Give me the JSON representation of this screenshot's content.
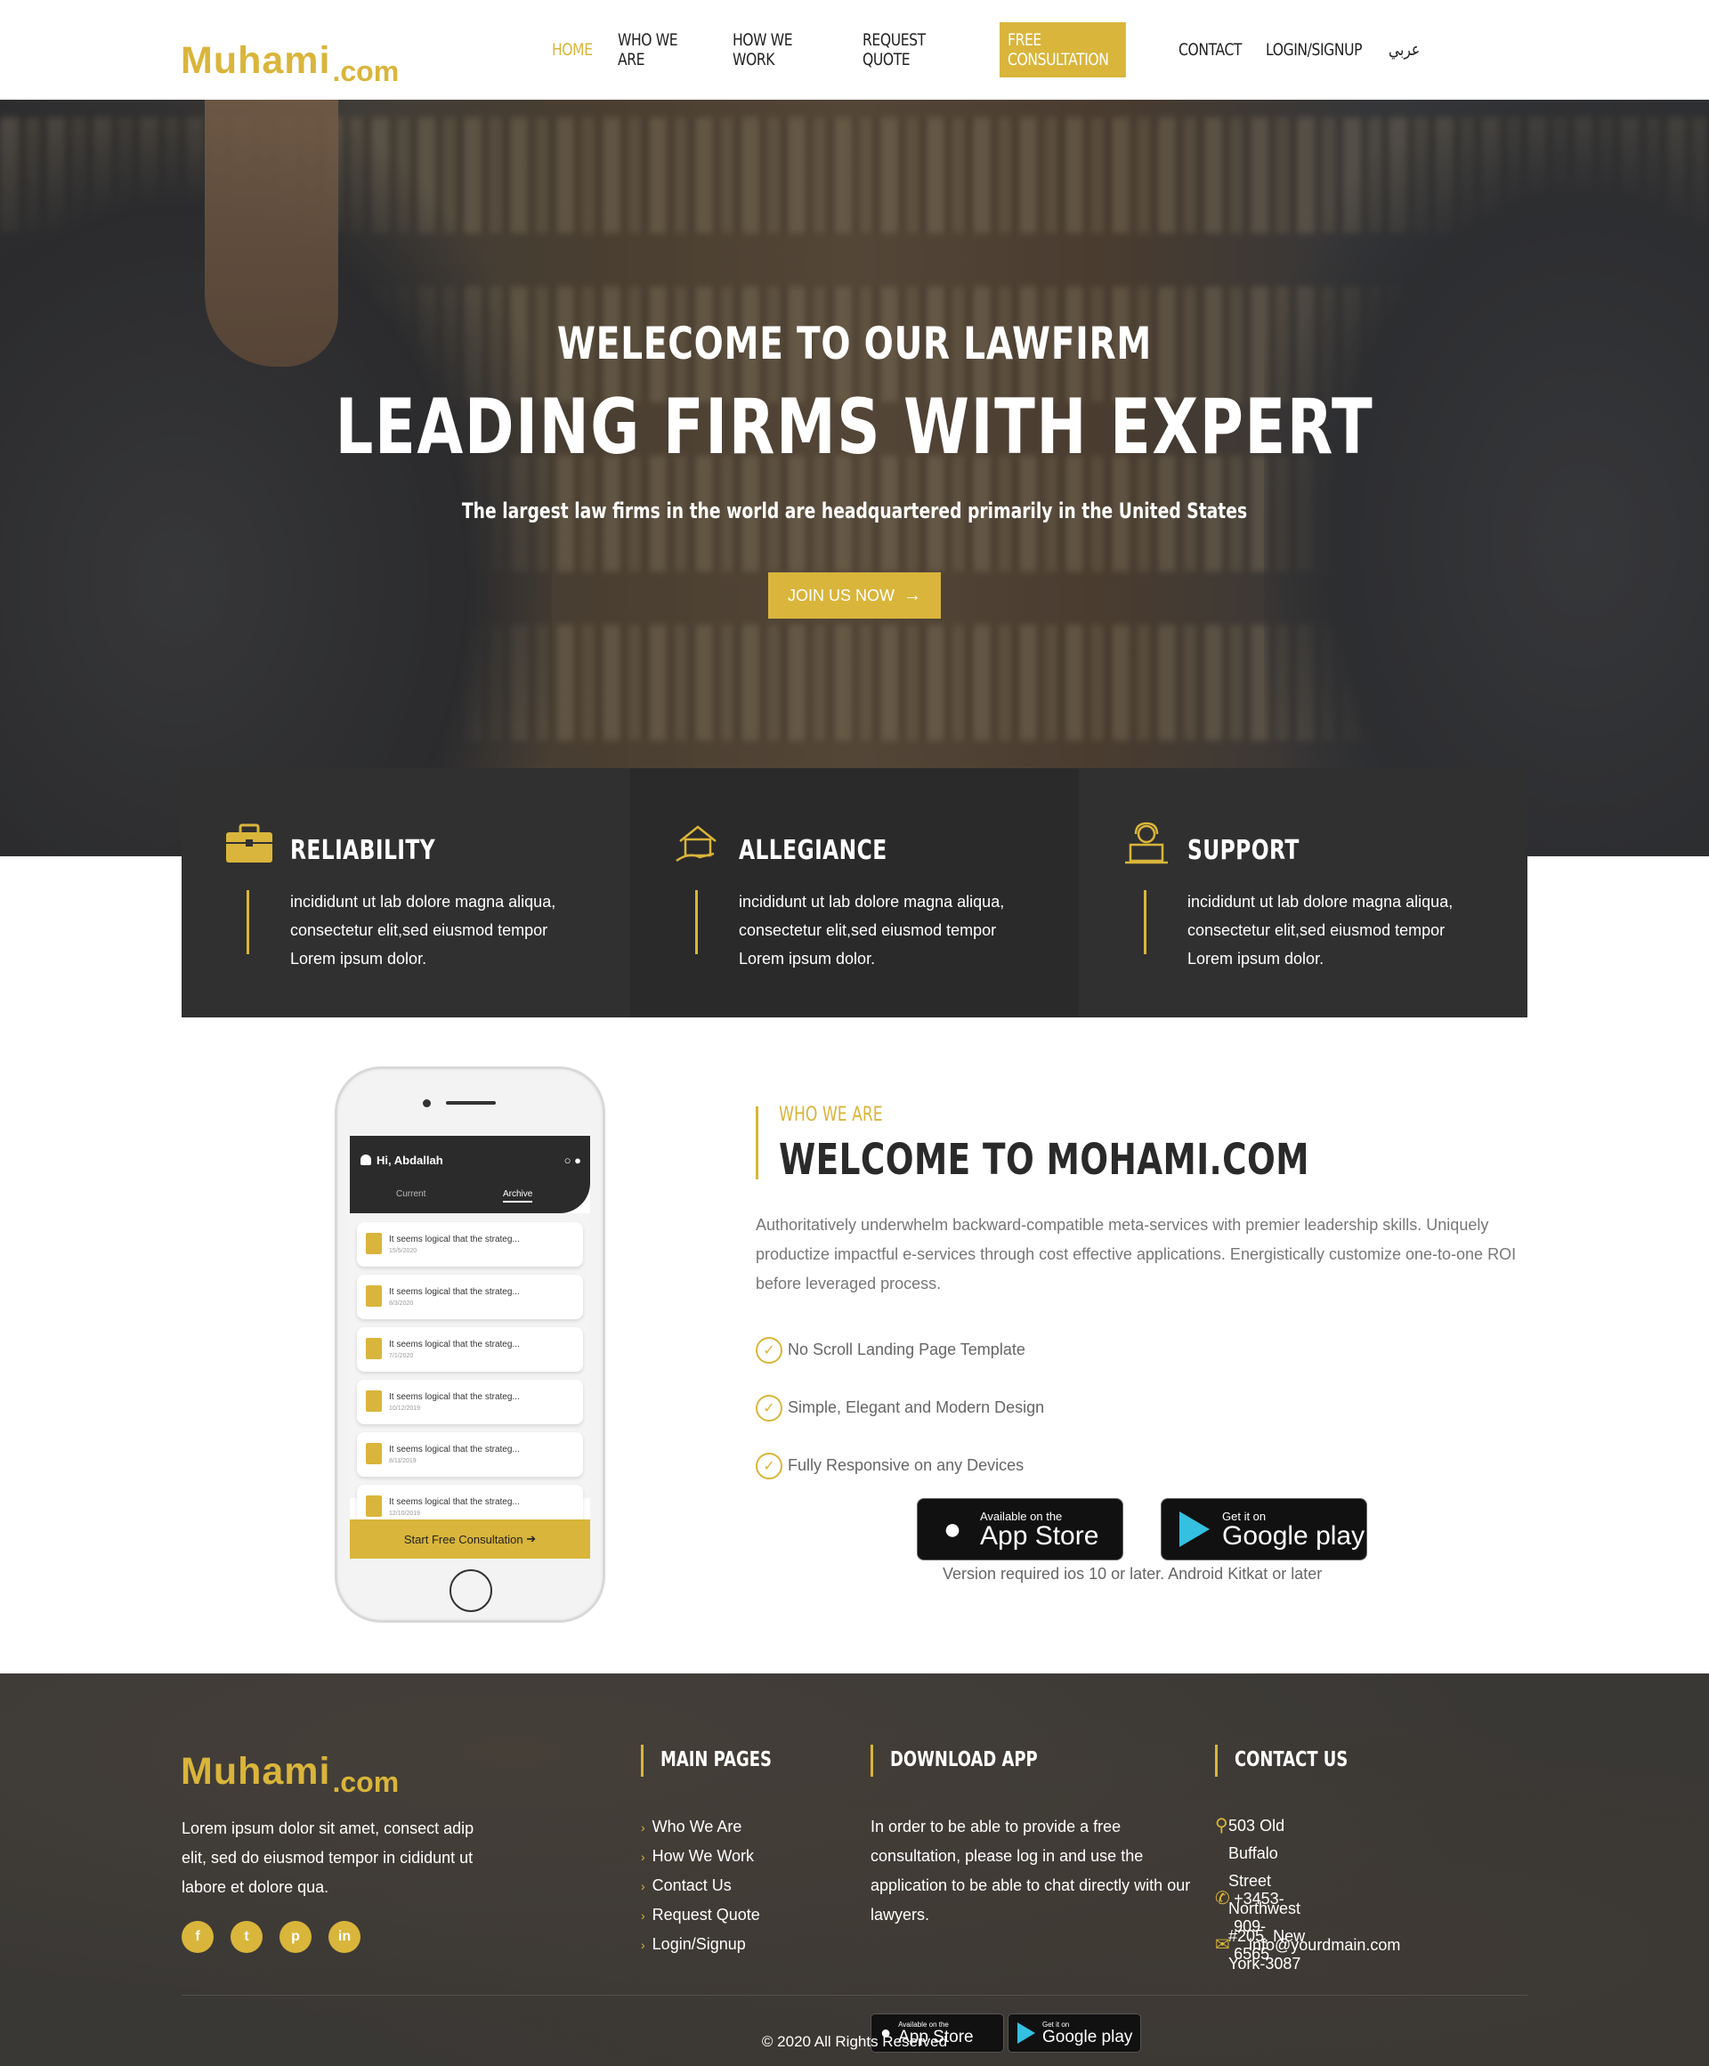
{
  "brand": {
    "logo_main": "Muhami",
    "logo_suffix": ".com"
  },
  "nav": {
    "items": [
      "HOME",
      "WHO WE ARE",
      "HOW WE WORK",
      "REQUEST QUOTE",
      "FREE CONSULTATION",
      "CONTACT",
      "LOGIN/SIGNUP",
      "عربي"
    ],
    "active": "HOME",
    "cta": "FREE CONSULTATION"
  },
  "hero": {
    "welcome": "WELECOME TO OUR LAWFIRM",
    "headline": "LEADING FIRMS WITH EXPERT",
    "subtitle": "The largest law firms in the world are headquartered primarily in the United States",
    "button_label": "JOIN US NOW",
    "button_icon": "arrow-right-icon"
  },
  "features": [
    {
      "title": "RELIABILITY",
      "icon": "briefcase-icon",
      "text": "incididunt ut lab dolore magna aliqua, consectetur elit,sed eiusmod tempor Lorem ipsum dolor."
    },
    {
      "title": "ALLEGIANCE",
      "icon": "house-hand-icon",
      "text": "incididunt ut lab dolore magna aliqua, consectetur elit,sed eiusmod tempor Lorem ipsum dolor."
    },
    {
      "title": "SUPPORT",
      "icon": "support-agent-icon",
      "text": "incididunt ut lab dolore magna aliqua, consectetur elit,sed eiusmod tempor Lorem ipsum dolor."
    }
  ],
  "phone_app": {
    "greeting": "Hi, Abdallah",
    "tabs": [
      "Current",
      "Archive"
    ],
    "items": [
      {
        "title": "It seems logical that the strateg...",
        "date": "15/5/2020"
      },
      {
        "title": "It seems logical that the strateg...",
        "date": "8/3/2020"
      },
      {
        "title": "It seems logical that the strateg...",
        "date": "7/1/2020"
      },
      {
        "title": "It seems logical that the strateg...",
        "date": "10/12/2019"
      },
      {
        "title": "It seems logical that the strateg...",
        "date": "8/11/2019"
      },
      {
        "title": "It seems logical that the strateg...",
        "date": "12/10/2019"
      }
    ],
    "start_button": "Start Free Consultation"
  },
  "about": {
    "kicker": "WHO WE ARE",
    "title": "WELCOME TO MOHAMI.COM",
    "description": "Authoritatively underwhelm backward-compatible meta-services with premier leadership skills. Uniquely productize impactful e-services through cost effective applications. Energistically customize one-to-one ROI before leveraged process.",
    "checks": [
      "No Scroll Landing Page Template",
      "Simple, Elegant and Modern Design",
      "Fully Responsive on any Devices"
    ],
    "app_store": {
      "small": "Available on the",
      "big": "App Store"
    },
    "google_play": {
      "small": "Get it on",
      "big": "Google play"
    },
    "version_note": "Version required ios 10 or later. Android Kitkat or later"
  },
  "footer": {
    "about_text": "Lorem ipsum dolor sit amet, consect adip elit, sed do eiusmod tempor in cididunt ut labore et dolore qua.",
    "socials": [
      "facebook-icon",
      "twitter-icon",
      "pinterest-icon",
      "linkedin-icon"
    ],
    "main_pages": {
      "title": "MAIN PAGES",
      "links": [
        "Who We Are",
        "How We Work",
        "Contact Us",
        "Request Quote",
        "Login/Signup"
      ]
    },
    "download_app": {
      "title": "DOWNLOAD APP",
      "text": "In order to be able to provide a free consultation, please log in and use the application to be able to chat directly with our lawyers."
    },
    "contact": {
      "title": "CONTACT US",
      "address_1": "503 Old Buffalo Street Northwest",
      "address_2": "#205, New York-3087",
      "phone": "+3453-909-6565",
      "email": "info@yourdmain.com"
    },
    "copyright": "© 2020 All Rights Reserved"
  },
  "colors": {
    "accent": "#d9b53b",
    "dark": "#303030",
    "footer_bg": "#3a3835"
  }
}
